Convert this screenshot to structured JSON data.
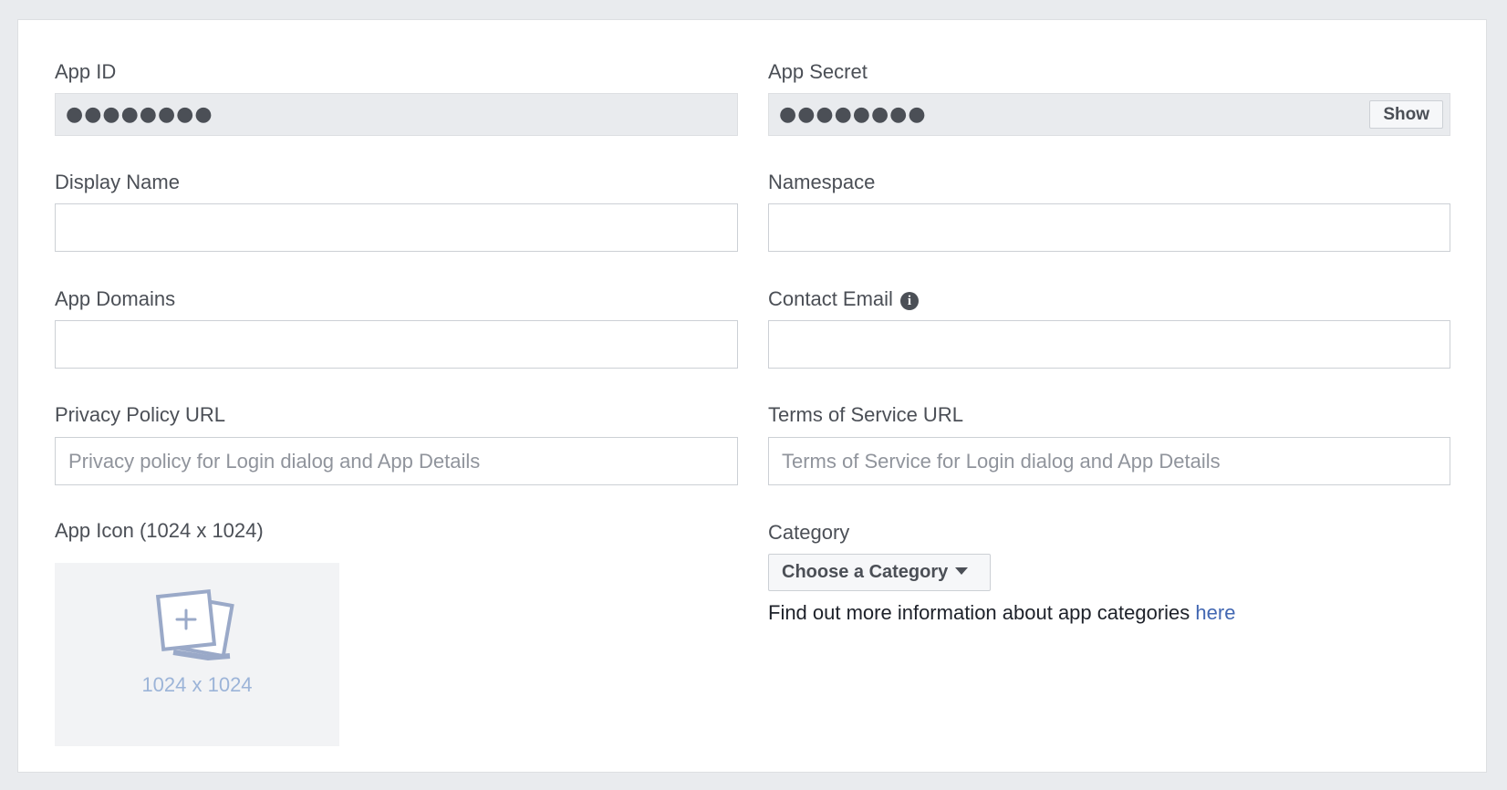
{
  "form": {
    "app_id": {
      "label": "App ID",
      "masked_value": "●●●●●●●●"
    },
    "app_secret": {
      "label": "App Secret",
      "masked_value": "●●●●●●●●",
      "show_button": "Show"
    },
    "display_name": {
      "label": "Display Name",
      "value": "",
      "placeholder": ""
    },
    "namespace": {
      "label": "Namespace",
      "value": "",
      "placeholder": ""
    },
    "app_domains": {
      "label": "App Domains",
      "value": "",
      "placeholder": ""
    },
    "contact_email": {
      "label": "Contact Email",
      "info_icon": "info-circle-icon",
      "value": "",
      "placeholder": ""
    },
    "privacy_policy_url": {
      "label": "Privacy Policy URL",
      "value": "",
      "placeholder": "Privacy policy for Login dialog and App Details"
    },
    "terms_of_service_url": {
      "label": "Terms of Service URL",
      "value": "",
      "placeholder": "Terms of Service for Login dialog and App Details"
    },
    "app_icon": {
      "label": "App Icon (1024 x 1024)",
      "size_text": "1024 x 1024",
      "icon": "add-image-icon"
    },
    "category": {
      "label": "Category",
      "selected": "Choose a Category",
      "info_text": "Find out more information about app categories",
      "link_text": "here"
    }
  },
  "colors": {
    "page_background": "#e9ebee",
    "panel_background": "#ffffff",
    "label_text": "#4b4f56",
    "link": "#4267b2",
    "icon_placeholder": "#9cb4d8"
  }
}
